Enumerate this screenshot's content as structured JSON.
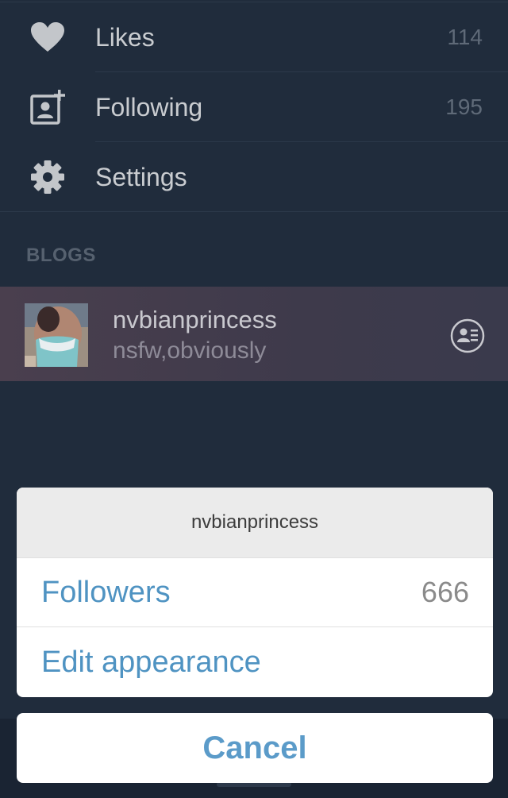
{
  "menu": {
    "items": [
      {
        "icon": "heart-icon",
        "label": "Likes",
        "count": "114"
      },
      {
        "icon": "add-user-icon",
        "label": "Following",
        "count": "195"
      },
      {
        "icon": "gear-icon",
        "label": "Settings"
      }
    ]
  },
  "blogs": {
    "header": "BLOGS",
    "items": [
      {
        "name": "nvbianprincess",
        "description": "nsfw,obviously",
        "action_icon": "profile-card-icon"
      }
    ]
  },
  "action_sheet": {
    "title": "nvbianprincess",
    "options": [
      {
        "label": "Followers",
        "value": "666"
      },
      {
        "label": "Edit appearance"
      }
    ],
    "cancel_label": "Cancel"
  },
  "colors": {
    "background": "#202c3c",
    "accent": "#4f93c2",
    "selected_row": "#453d4d"
  }
}
